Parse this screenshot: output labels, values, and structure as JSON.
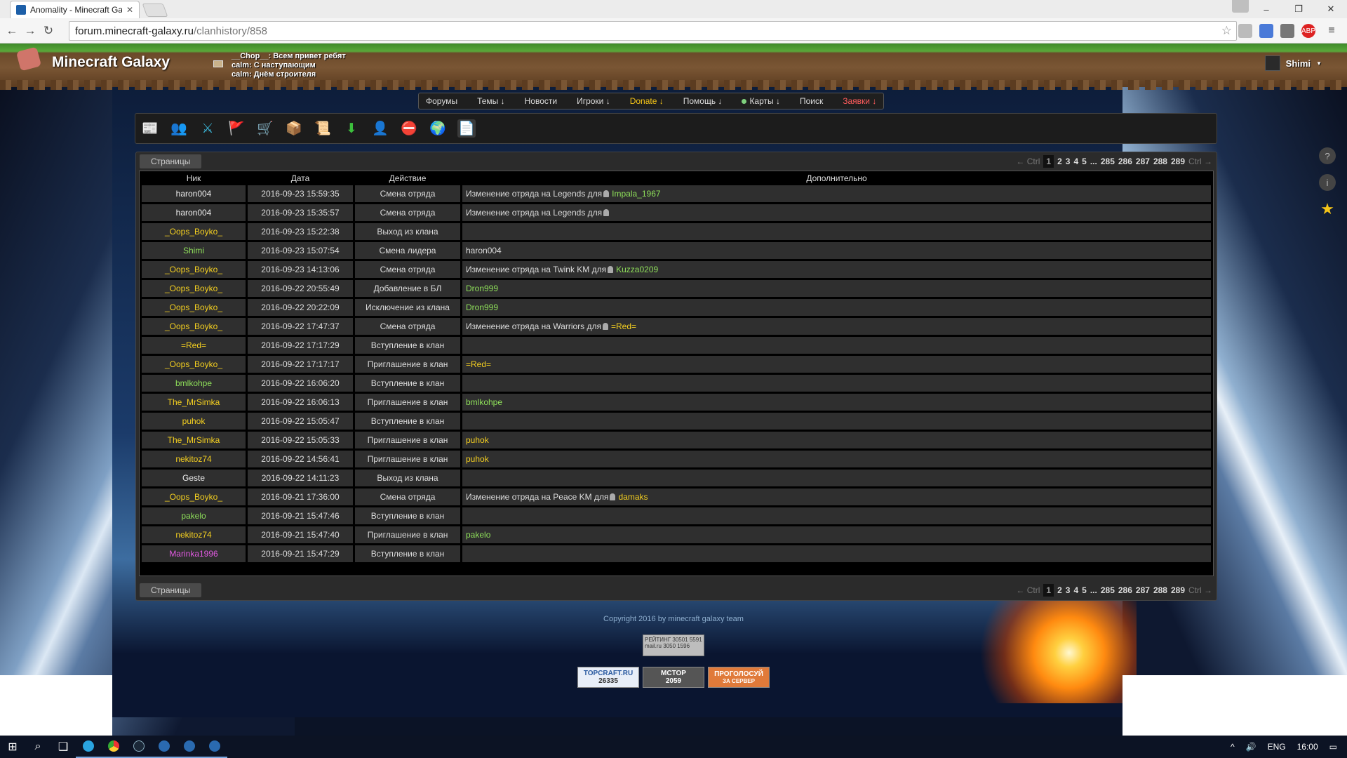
{
  "browser": {
    "tab_title": "Anomality - Minecraft Gal",
    "tab_close": "✕",
    "url_host": "forum.minecraft-galaxy.ru",
    "url_path": "/clanhistory/858",
    "back": "←",
    "forward": "→",
    "reload": "↻",
    "bookmark_star": "☆",
    "win_minimize": "–",
    "win_maximize": "❐",
    "win_close": "✕",
    "abp_label": "ABP"
  },
  "header": {
    "logo_text": "Minecraft Galaxy",
    "shouts": [
      "__Chop__: Всем привет ребят",
      "calm: С наступающим",
      "calm: Днём строителя"
    ],
    "username": "Shimi",
    "user_caret": "▼"
  },
  "nav": {
    "items": [
      "Форумы",
      "Темы ↓",
      "Новости",
      "Игроки ↓",
      "Donate ↓",
      "Помощь ↓",
      "Карты ↓",
      "Поиск",
      "Заявки ↓"
    ]
  },
  "toolbar": {
    "icons": [
      "📰",
      "👥",
      "⚔",
      "🚩",
      "🛒",
      "📦",
      "📜",
      "⬇",
      "👤",
      "⛔",
      "🌍",
      "📄"
    ]
  },
  "pager": {
    "label": "Страницы",
    "prev": "← Ctrl",
    "next": "Ctrl →",
    "current": "1",
    "pages": [
      "2",
      "3",
      "4",
      "5",
      "...",
      "285",
      "286",
      "287",
      "288",
      "289"
    ]
  },
  "table": {
    "headers": [
      "Ник",
      "Дата",
      "Действие",
      "Дополнительно"
    ],
    "rows": [
      {
        "nick": "haron004",
        "nick_color": "white",
        "date": "2016-09-23 15:59:35",
        "action": "Смена отряда",
        "extra_text": "Изменение отряда на Legends для",
        "extra_user": "Impala_1967",
        "extra_user_color": "green",
        "has_user_icon": true
      },
      {
        "nick": "haron004",
        "nick_color": "white",
        "date": "2016-09-23 15:35:57",
        "action": "Смена отряда",
        "extra_text": "Изменение отряда на Legends для",
        "extra_user": "",
        "extra_user_color": "green",
        "has_user_icon": true
      },
      {
        "nick": "_Oops_Boyko_",
        "nick_color": "yellow",
        "date": "2016-09-23 15:22:38",
        "action": "Выход из клана",
        "extra_text": "",
        "extra_user": "",
        "extra_user_color": "",
        "has_user_icon": false
      },
      {
        "nick": "Shimi",
        "nick_color": "green",
        "date": "2016-09-23 15:07:54",
        "action": "Смена лидера",
        "extra_text": "haron004",
        "extra_user": "",
        "extra_user_color": "",
        "has_user_icon": false
      },
      {
        "nick": "_Oops_Boyko_",
        "nick_color": "yellow",
        "date": "2016-09-23 14:13:06",
        "action": "Смена отряда",
        "extra_text": "Изменение отряда на Twink KM для",
        "extra_user": "Kuzza0209",
        "extra_user_color": "green",
        "has_user_icon": true
      },
      {
        "nick": "_Oops_Boyko_",
        "nick_color": "yellow",
        "date": "2016-09-22 20:55:49",
        "action": "Добавление в БЛ",
        "extra_text": "",
        "extra_user": "Dron999",
        "extra_user_color": "green",
        "has_user_icon": false
      },
      {
        "nick": "_Oops_Boyko_",
        "nick_color": "yellow",
        "date": "2016-09-22 20:22:09",
        "action": "Исключение из клана",
        "extra_text": "",
        "extra_user": "Dron999",
        "extra_user_color": "green",
        "has_user_icon": false
      },
      {
        "nick": "_Oops_Boyko_",
        "nick_color": "yellow",
        "date": "2016-09-22 17:47:37",
        "action": "Смена отряда",
        "extra_text": "Изменение отряда на Warriors для",
        "extra_user": "=Red=",
        "extra_user_color": "yellow",
        "has_user_icon": true
      },
      {
        "nick": "=Red=",
        "nick_color": "yellow",
        "date": "2016-09-22 17:17:29",
        "action": "Вступление в клан",
        "extra_text": "",
        "extra_user": "",
        "extra_user_color": "",
        "has_user_icon": false
      },
      {
        "nick": "_Oops_Boyko_",
        "nick_color": "yellow",
        "date": "2016-09-22 17:17:17",
        "action": "Приглашение в клан",
        "extra_text": "",
        "extra_user": "=Red=",
        "extra_user_color": "yellow",
        "has_user_icon": false
      },
      {
        "nick": "bmlkohpe",
        "nick_color": "green",
        "date": "2016-09-22 16:06:20",
        "action": "Вступление в клан",
        "extra_text": "",
        "extra_user": "",
        "extra_user_color": "",
        "has_user_icon": false
      },
      {
        "nick": "The_MrSimka",
        "nick_color": "yellow",
        "date": "2016-09-22 16:06:13",
        "action": "Приглашение в клан",
        "extra_text": "",
        "extra_user": "bmlkohpe",
        "extra_user_color": "green",
        "has_user_icon": false
      },
      {
        "nick": "puhok",
        "nick_color": "yellow",
        "date": "2016-09-22 15:05:47",
        "action": "Вступление в клан",
        "extra_text": "",
        "extra_user": "",
        "extra_user_color": "",
        "has_user_icon": false
      },
      {
        "nick": "The_MrSimka",
        "nick_color": "yellow",
        "date": "2016-09-22 15:05:33",
        "action": "Приглашение в клан",
        "extra_text": "",
        "extra_user": "puhok",
        "extra_user_color": "yellow",
        "has_user_icon": false
      },
      {
        "nick": "nekitoz74",
        "nick_color": "yellow",
        "date": "2016-09-22 14:56:41",
        "action": "Приглашение в клан",
        "extra_text": "",
        "extra_user": "puhok",
        "extra_user_color": "yellow",
        "has_user_icon": false
      },
      {
        "nick": "Geste",
        "nick_color": "white",
        "date": "2016-09-22 14:11:23",
        "action": "Выход из клана",
        "extra_text": "",
        "extra_user": "",
        "extra_user_color": "",
        "has_user_icon": false
      },
      {
        "nick": "_Oops_Boyko_",
        "nick_color": "yellow",
        "date": "2016-09-21 17:36:00",
        "action": "Смена отряда",
        "extra_text": "Изменение отряда на Peace KM для",
        "extra_user": "damaks",
        "extra_user_color": "yellow",
        "has_user_icon": true
      },
      {
        "nick": "pakelo",
        "nick_color": "green",
        "date": "2016-09-21 15:47:46",
        "action": "Вступление в клан",
        "extra_text": "",
        "extra_user": "",
        "extra_user_color": "",
        "has_user_icon": false
      },
      {
        "nick": "nekitoz74",
        "nick_color": "yellow",
        "date": "2016-09-21 15:47:40",
        "action": "Приглашение в клан",
        "extra_text": "",
        "extra_user": "pakelo",
        "extra_user_color": "green",
        "has_user_icon": false
      },
      {
        "nick": "Marinka1996",
        "nick_color": "magenta",
        "date": "2016-09-21 15:47:29",
        "action": "Вступление в клан",
        "extra_text": "",
        "extra_user": "",
        "extra_user_color": "",
        "has_user_icon": false
      }
    ]
  },
  "footer": {
    "copyright": "Copyright 2016 by minecraft galaxy team",
    "counter_line1": "РЕЙТИНГ 30501 5591",
    "counter_line2": "mail.ru 3050 1596",
    "badge1_title": "TOPCRAFT.RU",
    "badge1_value": "26335",
    "badge2_title": "MCTOP",
    "badge2_value": "2059",
    "badge3_title": "ПРОГОЛОСУЙ",
    "badge3_sub": "ЗА СЕРВЕР"
  },
  "taskbar": {
    "lang": "ENG",
    "time": "16:00",
    "start_icon": "⊞",
    "search_icon": "⌕",
    "taskview_icon": "❑"
  },
  "colors": {
    "white": "#eeeeee",
    "yellow": "#f5d020",
    "green": "#8fe05a",
    "magenta": "#e25ae2"
  }
}
